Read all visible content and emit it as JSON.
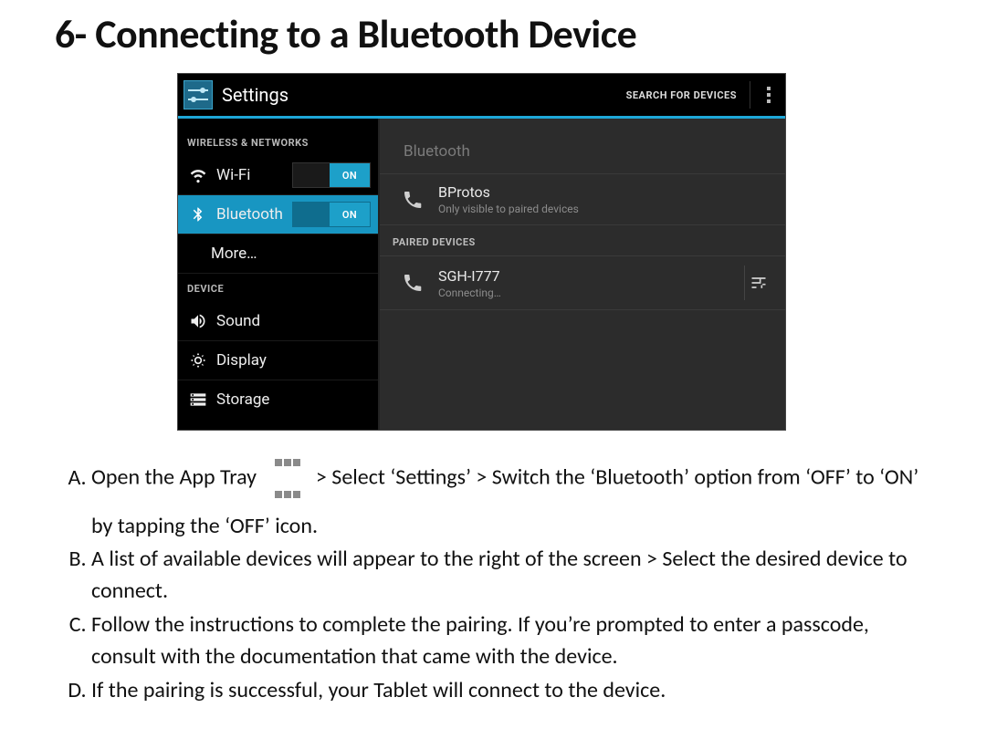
{
  "title": "6- Connecting to a Bluetooth Device",
  "screenshot": {
    "action_bar": {
      "title": "Settings",
      "search_label": "SEARCH FOR DEVICES"
    },
    "left": {
      "section1": "WIRELESS & NETWORKS",
      "wifi_label": "Wi-Fi",
      "wifi_toggle": "ON",
      "bt_label": "Bluetooth",
      "bt_toggle": "ON",
      "more_label": "More…",
      "section2": "DEVICE",
      "sound_label": "Sound",
      "display_label": "Display",
      "storage_label": "Storage"
    },
    "right": {
      "title": "Bluetooth",
      "self": {
        "name": "BProtos",
        "sub": "Only visible to paired devices"
      },
      "paired_header": "PAIRED DEVICES",
      "paired": {
        "name": "SGH-I777",
        "sub": "Connecting…"
      }
    }
  },
  "steps": {
    "a1": "Open the App Tray",
    "a2": "> Select ‘Settings’ > Switch the ‘Bluetooth’ option from ‘OFF’ to ‘ON’ by tapping the ‘OFF’ icon.",
    "b": "A list of available devices will appear to the right of the screen > Select the desired device to connect.",
    "c": "Follow the instructions to complete the pairing. If you’re prompted to enter a passcode, consult with the documentation that came with the device.",
    "d": "If the pairing is successful, your Tablet will connect to the device."
  }
}
